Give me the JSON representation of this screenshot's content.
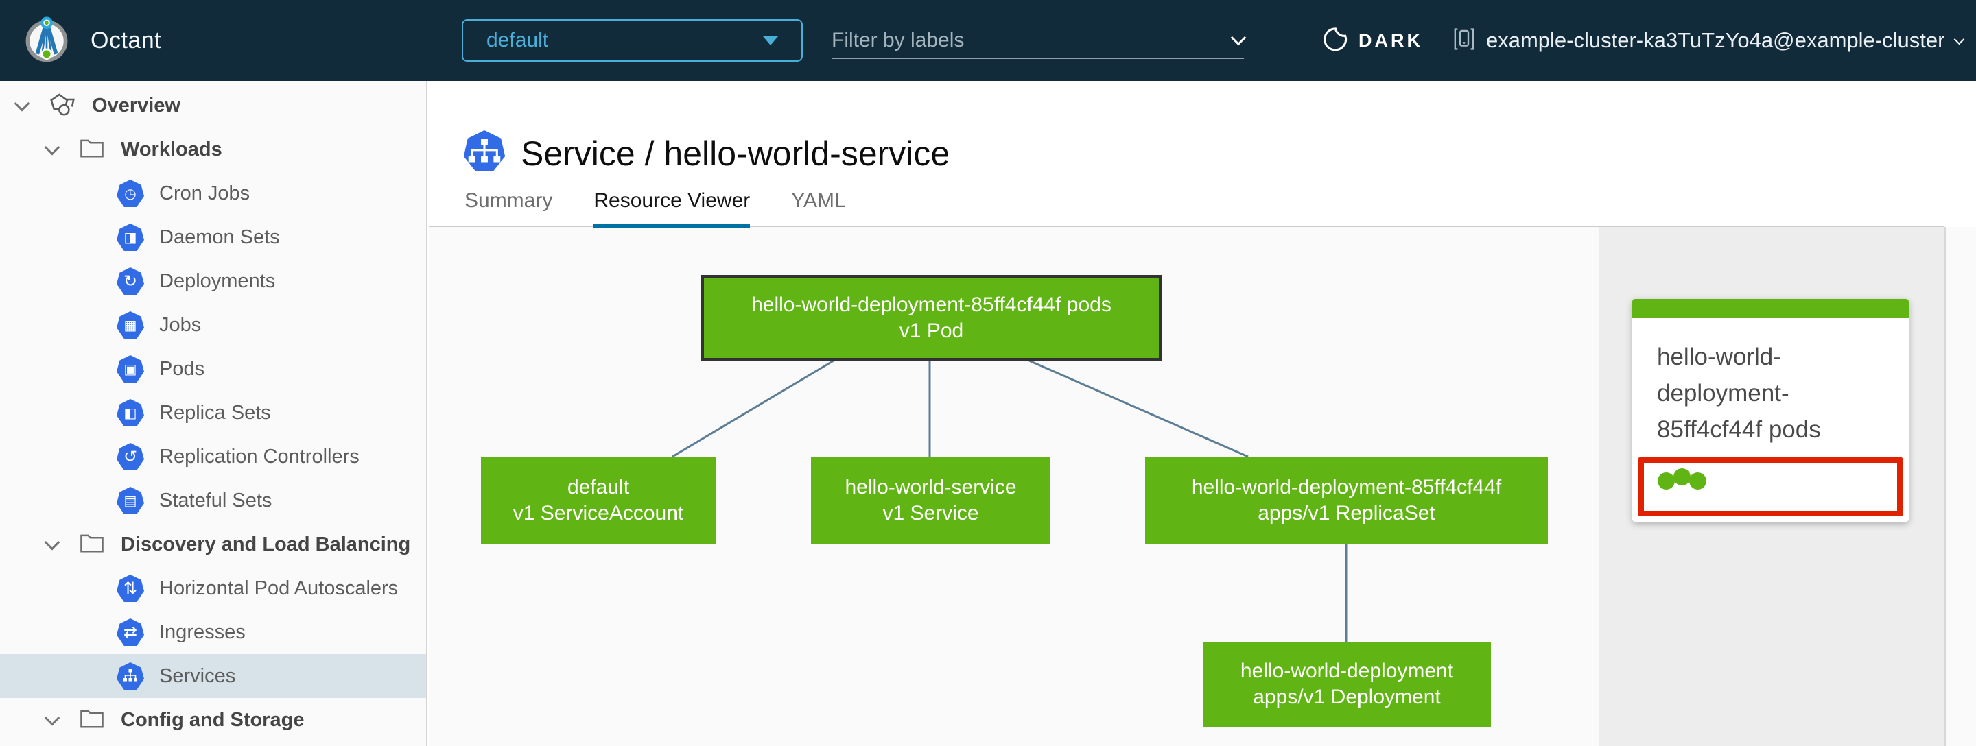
{
  "header": {
    "app_name": "Octant",
    "namespace_dropdown": {
      "value": "default"
    },
    "label_filter": {
      "placeholder": "Filter by labels"
    },
    "theme_toggle_label": "DARK",
    "context_selector": {
      "value": "example-cluster-ka3TuTzYo4a@example-cluster"
    }
  },
  "sidebar": {
    "items": [
      {
        "label": "Overview",
        "icon": "objects-icon",
        "level": 0
      },
      {
        "label": "Workloads",
        "icon": "folder-icon",
        "level": 1
      },
      {
        "label": "Cron Jobs",
        "icon": "k8s-cronjob-icon",
        "level": 2
      },
      {
        "label": "Daemon Sets",
        "icon": "k8s-daemonset-icon",
        "level": 2
      },
      {
        "label": "Deployments",
        "icon": "k8s-deployment-icon",
        "level": 2
      },
      {
        "label": "Jobs",
        "icon": "k8s-job-icon",
        "level": 2
      },
      {
        "label": "Pods",
        "icon": "k8s-pod-icon",
        "level": 2
      },
      {
        "label": "Replica Sets",
        "icon": "k8s-replicaset-icon",
        "level": 2
      },
      {
        "label": "Replication Controllers",
        "icon": "k8s-replicationcontroller-icon",
        "level": 2
      },
      {
        "label": "Stateful Sets",
        "icon": "k8s-statefulset-icon",
        "level": 2
      },
      {
        "label": "Discovery and Load Balancing",
        "icon": "folder-icon",
        "level": 1
      },
      {
        "label": "Horizontal Pod Autoscalers",
        "icon": "k8s-hpa-icon",
        "level": 2
      },
      {
        "label": "Ingresses",
        "icon": "k8s-ingress-icon",
        "level": 2
      },
      {
        "label": "Services",
        "icon": "k8s-service-icon",
        "level": 2,
        "selected": true
      },
      {
        "label": "Config and Storage",
        "icon": "folder-icon",
        "level": 1
      }
    ]
  },
  "main": {
    "page_title": "Service / hello-world-service",
    "active_tab": "Resource Viewer",
    "tabs": [
      {
        "label": "Summary"
      },
      {
        "label": "Resource Viewer"
      },
      {
        "label": "YAML"
      }
    ]
  },
  "graph": {
    "nodes": [
      {
        "line1": "hello-world-deployment-85ff4cf44f pods",
        "line2": "v1 Pod",
        "selected": true
      },
      {
        "line1": "default",
        "line2": "v1 ServiceAccount",
        "selected": false
      },
      {
        "line1": "hello-world-service",
        "line2": "v1 Service",
        "selected": false
      },
      {
        "line1": "hello-world-deployment-85ff4cf44f",
        "line2": "apps/v1 ReplicaSet",
        "selected": false
      },
      {
        "line1": "hello-world-deployment",
        "line2": "apps/v1 Deployment",
        "selected": false
      }
    ]
  },
  "detail_panel": {
    "title": "hello-world-deployment-85ff4cf44f pods",
    "status_dots": 3
  },
  "colors": {
    "header_bg": "#122b3a",
    "accent_blue": "#49afd9",
    "k8s_blue": "#316ce6",
    "node_green": "#60b515",
    "edge_blue": "#5c7d95",
    "alert_red": "#e12200",
    "tab_underline": "#0072a3",
    "nav_selected_bg": "#d8e2e9"
  }
}
